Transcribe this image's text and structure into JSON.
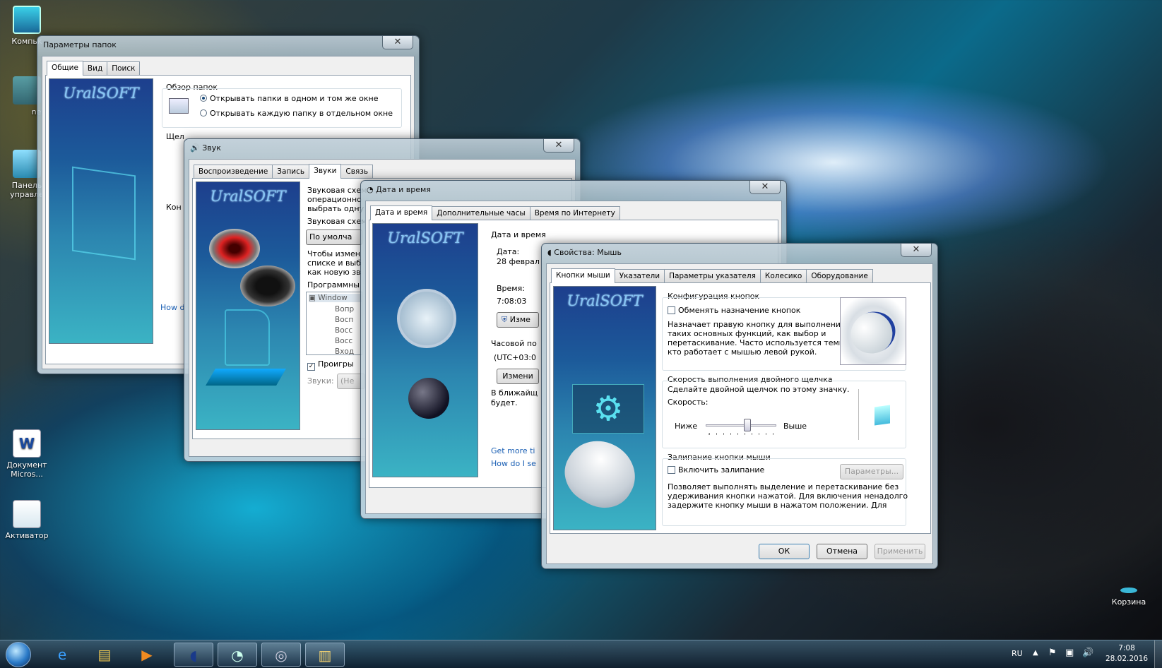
{
  "desktop": {
    "icons": [
      {
        "label": "Компьк",
        "icon": "computer-icon"
      },
      {
        "label": "new",
        "icon": "folder-icon"
      },
      {
        "label": "Панель управле",
        "icon": "control-panel-icon"
      },
      {
        "label": "Документ Micros...",
        "icon": "word-document-icon"
      },
      {
        "label": "Активатор",
        "icon": "activator-icon"
      },
      {
        "label": "Корзина",
        "icon": "recycle-bin-icon"
      }
    ]
  },
  "folder_options": {
    "title": "Параметры папок",
    "close": "✕",
    "tabs": [
      "Общие",
      "Вид",
      "Поиск"
    ],
    "logo": "UralSOFT",
    "browse_group": "Обзор папок",
    "radio1": "Открывать папки в одном и том же окне",
    "radio2": "Открывать каждую папку в отдельном окне",
    "click_label": "Щел",
    "nav_label": "Кон",
    "how_link": "How d"
  },
  "sound": {
    "title": "Звук",
    "close": "✕",
    "tabs": [
      "Воспроизведение",
      "Запись",
      "Звуки",
      "Связь"
    ],
    "logo": "UralSOFT",
    "desc1": "Звуковая схем",
    "desc2": "операционно",
    "desc3": "выбрать одну",
    "scheme_label": "Звуковая схем",
    "scheme_value": "По умолча",
    "change1": "Чтобы измен",
    "change2": "списке и выб",
    "change3": "как новую зв",
    "programs_label": "Программны",
    "tree": [
      "Window",
      "Вопр",
      "Восп",
      "Восс",
      "Восс",
      "Вход"
    ],
    "play_check": "Проигры",
    "sounds_label": "Звуки:",
    "sounds_value": "(Не"
  },
  "datetime": {
    "title": "Дата и время",
    "close": "✕",
    "tabs": [
      "Дата и время",
      "Дополнительные часы",
      "Время по Интернету"
    ],
    "logo": "UralSOFT",
    "heading": "Дата и время",
    "date_label": "Дата:",
    "date_value": "28 феврал",
    "time_label": "Время:",
    "time_value": "7:08:03",
    "change_btn": "Изме",
    "tz_label": "Часовой по",
    "tz_value": "(UTC+03:0",
    "change_tz_btn": "Измени",
    "note1": "В ближайщ",
    "note2": "будет.",
    "link1": "Get more ti",
    "link2": "How do I se"
  },
  "mouse": {
    "title": "Свойства: Мышь",
    "close": "✕",
    "tabs": [
      "Кнопки мыши",
      "Указатели",
      "Параметры указателя",
      "Колесико",
      "Оборудование"
    ],
    "logo": "UralSOFT",
    "config_group": "Конфигурация кнопок",
    "swap_check": "Обменять назначение кнопок",
    "swap_desc": [
      "Назначает правую кнопку для выполнения",
      "таких основных функций, как выбор и",
      "перетаскивание. Часто используется теми,",
      "кто работает с мышью левой рукой."
    ],
    "dbl_group": "Скорость выполнения двойного щелчка",
    "dbl_desc": "Сделайте двойной щелчок по этому значку.",
    "speed_label": "Скорость:",
    "slow": "Ниже",
    "fast": "Выше",
    "speed_value": 0.6,
    "lock_group": "Залипание кнопки мыши",
    "lock_check": "Включить залипание",
    "params_btn": "Параметры...",
    "lock_desc": [
      "Позволяет выполнять выделение и перетаскивание без",
      "удерживания кнопки нажатой. Для включения ненадолго",
      "задержите кнопку мыши в нажатом положении. Для"
    ],
    "ok": "ОК",
    "cancel": "Отмена",
    "apply": "Применить"
  },
  "taskbar": {
    "lang": "RU",
    "time": "7:08",
    "date": "28.02.2016"
  }
}
